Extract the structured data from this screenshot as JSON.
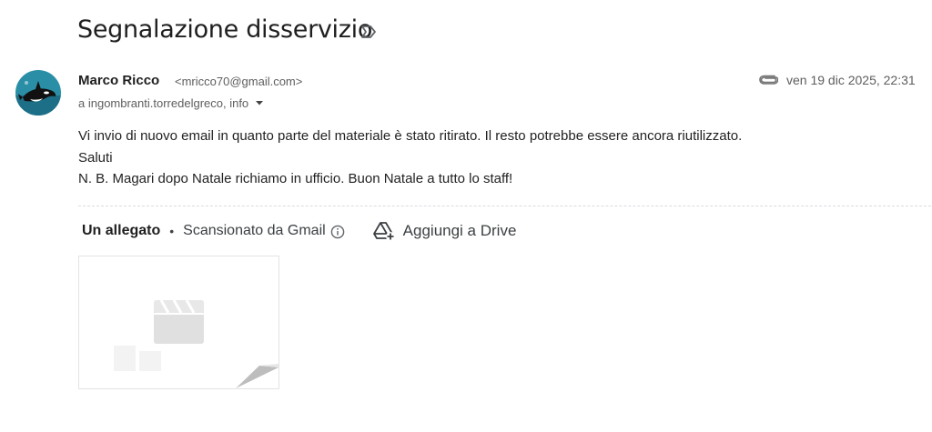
{
  "message": {
    "subject": "Segnalazione disservizio",
    "sender_name": "Marco Ricco",
    "sender_email": "<mricco70@gmail.com>",
    "recipients": "a ingombranti.torredelgreco, info",
    "date": "ven 19 dic 2025, 22:31",
    "body_lines": [
      "Vi invio di nuovo email in quanto parte del materiale è stato ritirato. Il resto potrebbe essere ancora riutilizzato.",
      "Saluti",
      "N. B. Magari dopo Natale richiamo in ufficio. Buon Natale a tutto lo staff!"
    ]
  },
  "attachments": {
    "title": "Un allegato",
    "separator": "•",
    "scan_text": "Scansionato da Gmail",
    "drive_label": "Aggiungi a Drive"
  },
  "icons": {
    "label": "label-outline-icon",
    "avatar": "orca-avatar",
    "recipients_caret": "caret-down-icon",
    "attachment": "paperclip-icon",
    "info": "info-icon",
    "drive": "add-to-drive-icon",
    "thumbnail": "video-file-icon"
  },
  "colors": {
    "text": "#1f1f1f",
    "secondary": "#5e5e5e",
    "avatar_bg": "#2a8fa6",
    "thumb_icon": "#e0e0e0"
  }
}
